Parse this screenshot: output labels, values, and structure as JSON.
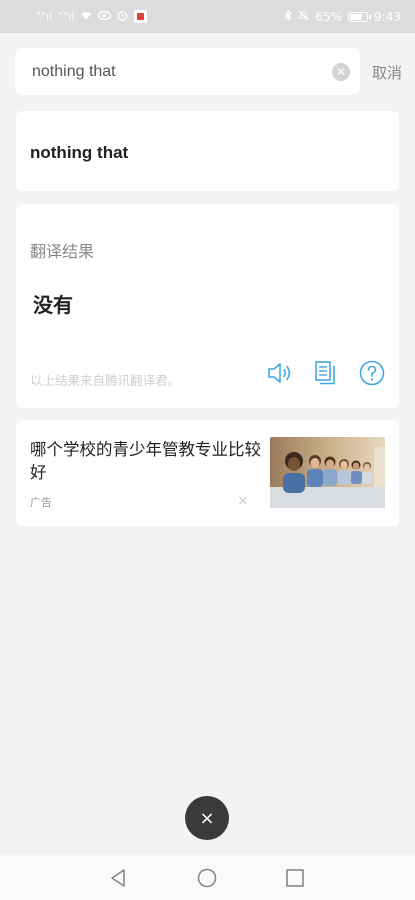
{
  "status_bar": {
    "signal_1": "\"\"ıl",
    "signal_2": "\"\"ıl",
    "battery_percent": "65%",
    "time": "9:43",
    "battery_level": 0.65
  },
  "search": {
    "value": "nothing that",
    "cancel_label": "取消"
  },
  "query": {
    "text": "nothing that"
  },
  "result": {
    "label": "翻译结果",
    "text": "没有",
    "source": "以上结果来自腾讯翻译君。"
  },
  "ad": {
    "title": "哪个学校的青少年管教专业比较好",
    "tag": "广告",
    "close": "×"
  },
  "float_close": "×",
  "colors": {
    "accent": "#3fa9e0",
    "background": "#f3f3f4",
    "status_bar": "#dcdcdf"
  }
}
